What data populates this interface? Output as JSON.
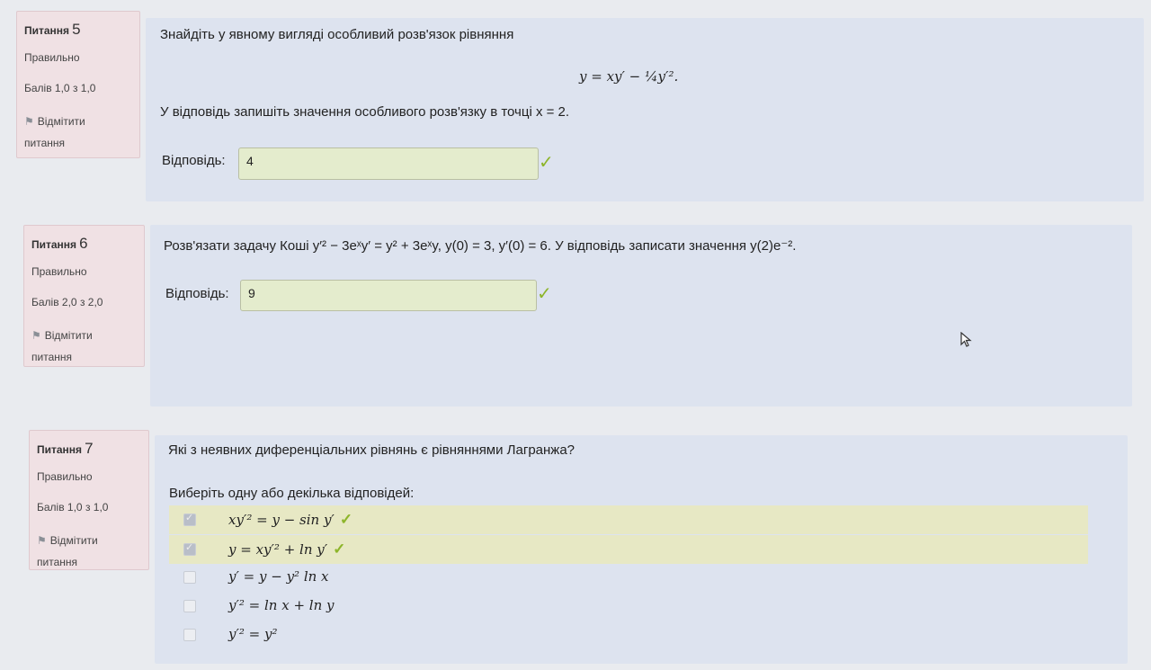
{
  "questions": [
    {
      "label": "Питання",
      "number": "5",
      "state": "Правильно",
      "grade": "Балів 1,0 з 1,0",
      "flag": "Відмітити питання",
      "text": "Знайдіть у явному вигляді особливий розв'язок рівняння",
      "equation": "y = xy′ − ¼y′².",
      "instruction": "У відповідь запишіть значення особливого розв'язку в точці x = 2.",
      "answer_label": "Відповідь:",
      "answer_value": "4"
    },
    {
      "label": "Питання",
      "number": "6",
      "state": "Правильно",
      "grade": "Балів 2,0 з 2,0",
      "flag": "Відмітити питання",
      "text": "Розв'язати задачу Коші y′² − 3eˣy′ = y² + 3eˣy, y(0) = 3, y′(0) = 6. У відповідь записати значення y(2)e⁻².",
      "answer_label": "Відповідь:",
      "answer_value": "9"
    },
    {
      "label": "Питання",
      "number": "7",
      "state": "Правильно",
      "grade": "Балів 1,0 з 1,0",
      "flag": "Відмітити питання",
      "text": "Які з неявних диференціальних рівнянь є рівняннями Лагранжа?",
      "prompt": "Виберіть одну або декілька відповідей:",
      "options": [
        {
          "text": "xy′² = y − sin y′",
          "checked": true,
          "correct": true
        },
        {
          "text": "y = xy′² + ln y′",
          "checked": true,
          "correct": true
        },
        {
          "text": "y′ = y − y² ln x",
          "checked": false,
          "correct": false
        },
        {
          "text": "y′² = ln x + ln y",
          "checked": false,
          "correct": false
        },
        {
          "text": "y′² = y²",
          "checked": false,
          "correct": false
        }
      ]
    }
  ],
  "check_mark": "✓",
  "flag_icon": "flag-icon"
}
